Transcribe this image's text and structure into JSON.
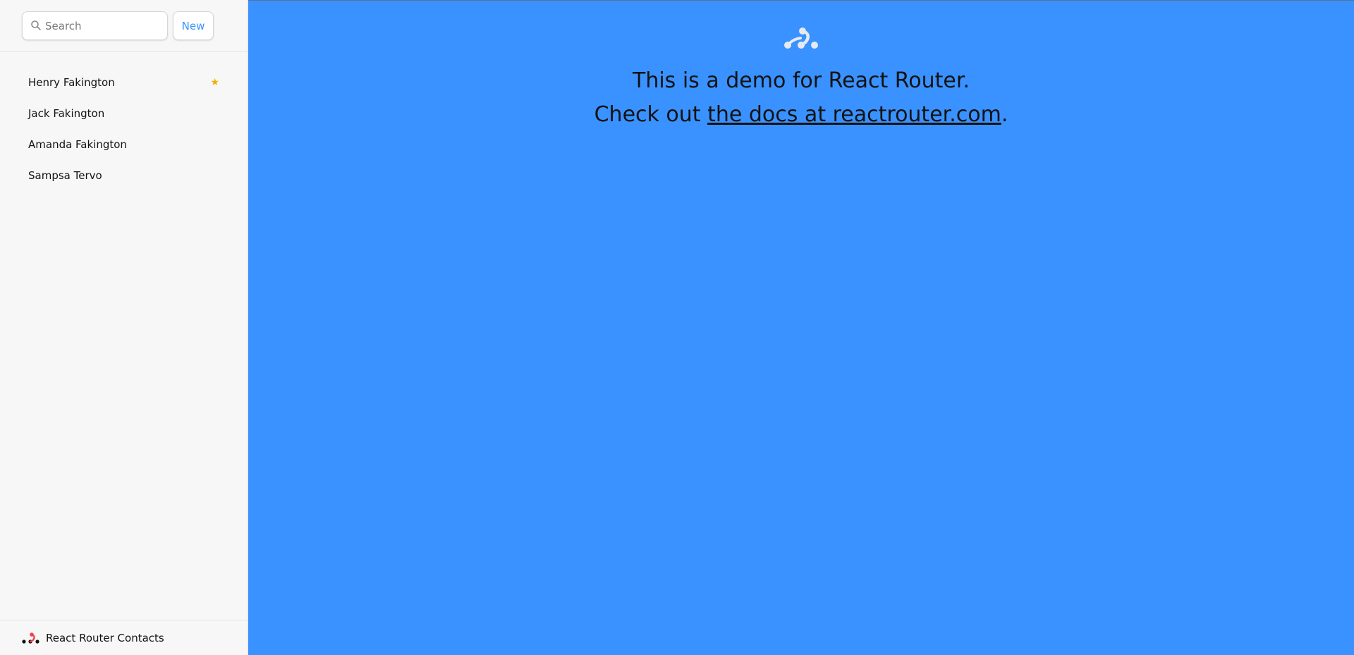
{
  "sidebar": {
    "search": {
      "placeholder": "Search",
      "value": ""
    },
    "new_label": "New",
    "contacts": [
      {
        "name": "Henry Fakington",
        "favorite": true
      },
      {
        "name": "Jack Fakington",
        "favorite": false
      },
      {
        "name": "Amanda Fakington",
        "favorite": false
      },
      {
        "name": "Sampsa Tervo",
        "favorite": false
      }
    ],
    "star_glyph": "★",
    "footer_title": "React Router Contacts"
  },
  "main": {
    "line1": "This is a demo for React Router.",
    "line2_prefix": "Check out ",
    "link_text": "the docs at reactrouter.com",
    "line2_suffix": "."
  },
  "colors": {
    "accent": "#3992ff",
    "star": "#eeb004",
    "logo_red": "#f44250"
  }
}
